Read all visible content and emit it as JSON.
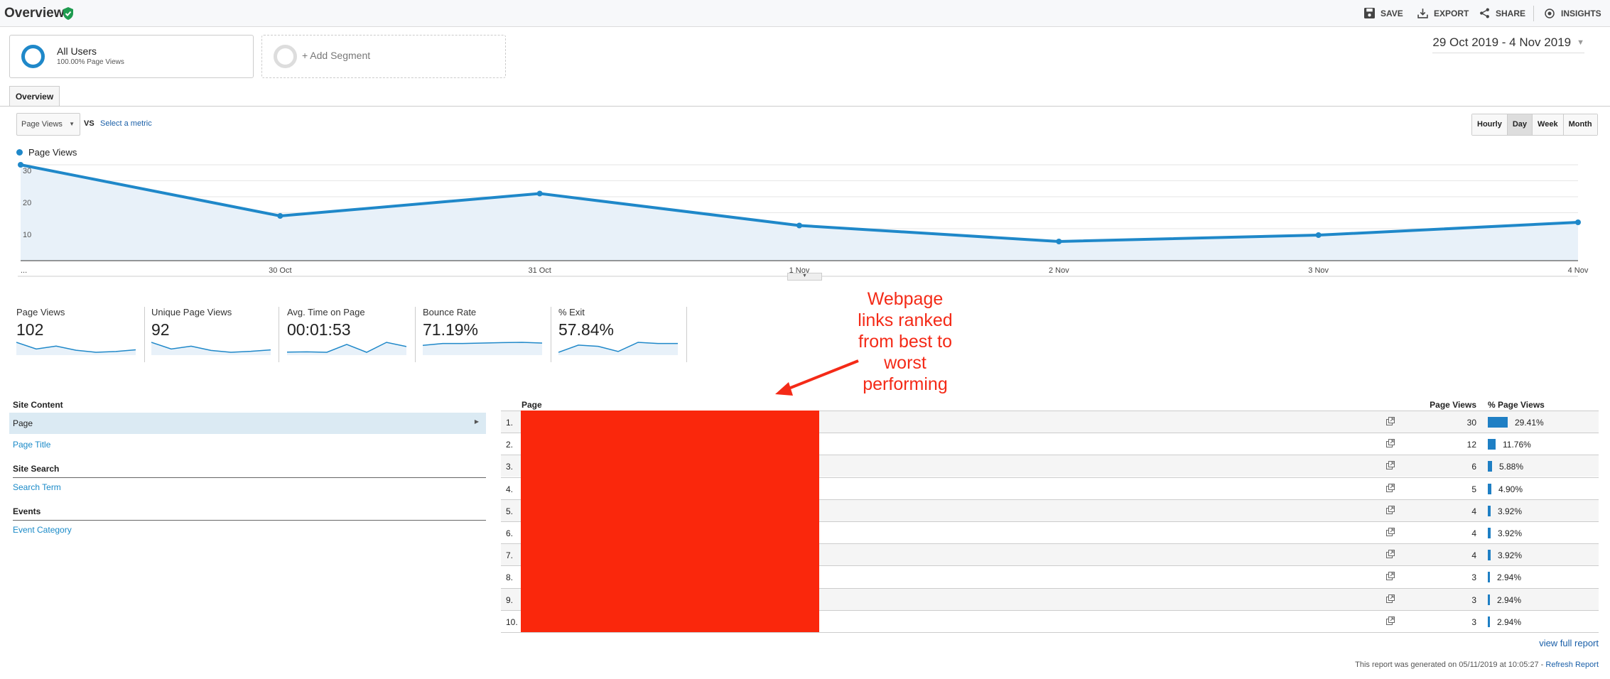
{
  "header": {
    "title": "Overview",
    "verified_icon": "shield-check-icon",
    "actions": [
      {
        "label": "SAVE",
        "icon": "save-icon"
      },
      {
        "label": "EXPORT",
        "icon": "download-icon"
      },
      {
        "label": "SHARE",
        "icon": "share-icon"
      },
      {
        "label": "INSIGHTS",
        "icon": "insights-icon"
      }
    ]
  },
  "segments": {
    "active": {
      "name": "All Users",
      "sub": "100.00% Page Views"
    },
    "add_label": "+ Add Segment"
  },
  "date_range": "29 Oct 2019 - 4 Nov 2019",
  "tabs": [
    {
      "label": "Overview",
      "active": true
    }
  ],
  "metric_select": {
    "value": "Page Views",
    "vs": "VS",
    "secondary": "Select a metric"
  },
  "granularity": {
    "options": [
      "Hourly",
      "Day",
      "Week",
      "Month"
    ],
    "selected": "Day"
  },
  "colors": {
    "accent": "#1f88c9",
    "fill": "#e8f1f9",
    "redaction": "#fa270c",
    "annotation": "#f42a17"
  },
  "chart_data": {
    "type": "area",
    "series": [
      {
        "name": "Page Views",
        "values": [
          30,
          14,
          21,
          11,
          6,
          8,
          12
        ]
      }
    ],
    "x": [
      "...",
      "30 Oct",
      "31 Oct",
      "1 Nov",
      "2 Nov",
      "3 Nov",
      "4 Nov"
    ],
    "y_ticks": [
      "10",
      "20",
      "30"
    ],
    "ylim": [
      0,
      30
    ],
    "grid": true,
    "legend": "top-left"
  },
  "scorecards": [
    {
      "label": "Page Views",
      "value": "102",
      "spark": [
        30,
        14,
        21,
        11,
        6,
        8,
        12
      ]
    },
    {
      "label": "Unique Page Views",
      "value": "92",
      "spark": [
        27,
        13,
        19,
        10,
        6,
        8,
        11
      ]
    },
    {
      "label": "Avg. Time on Page",
      "value": "00:01:53",
      "spark": [
        3,
        4,
        2,
        40,
        2,
        50,
        30
      ]
    },
    {
      "label": "Bounce Rate",
      "value": "71.19%",
      "spark": [
        60,
        68,
        68,
        70,
        72,
        73,
        70
      ]
    },
    {
      "label": "% Exit",
      "value": "57.84%",
      "spark": [
        40,
        58,
        55,
        42,
        65,
        62,
        62
      ]
    }
  ],
  "sidebar": {
    "sections": [
      {
        "title": "Site Content",
        "items": [
          {
            "label": "Page",
            "selected": true
          },
          {
            "label": "Page Title"
          }
        ]
      },
      {
        "title": "Site Search",
        "items": [
          {
            "label": "Search Term"
          }
        ]
      },
      {
        "title": "Events",
        "items": [
          {
            "label": "Event Category"
          }
        ]
      }
    ]
  },
  "table": {
    "headers": {
      "page": "Page",
      "pv": "Page Views",
      "pct": "% Page Views"
    },
    "rows": [
      {
        "n": "1.",
        "pv": "30",
        "pct": "29.41%",
        "pct_value": 29.41
      },
      {
        "n": "2.",
        "pv": "12",
        "pct": "11.76%",
        "pct_value": 11.76
      },
      {
        "n": "3.",
        "pv": "6",
        "pct": "5.88%",
        "pct_value": 5.88
      },
      {
        "n": "4.",
        "pv": "5",
        "pct": "4.90%",
        "pct_value": 4.9
      },
      {
        "n": "5.",
        "pv": "4",
        "pct": "3.92%",
        "pct_value": 3.92
      },
      {
        "n": "6.",
        "pv": "4",
        "pct": "3.92%",
        "pct_value": 3.92
      },
      {
        "n": "7.",
        "pv": "4",
        "pct": "3.92%",
        "pct_value": 3.92
      },
      {
        "n": "8.",
        "pv": "3",
        "pct": "2.94%",
        "pct_value": 2.94
      },
      {
        "n": "9.",
        "pv": "3",
        "pct": "2.94%",
        "pct_value": 2.94
      },
      {
        "n": "10.",
        "pv": "3",
        "pct": "2.94%",
        "pct_value": 2.94
      }
    ],
    "view_full": "view full report"
  },
  "footer": {
    "text": "This report was generated on 05/11/2019 at 10:05:27 - ",
    "refresh": "Refresh Report"
  },
  "annotation": {
    "lines": [
      "Webpage",
      "links ranked",
      "from best to",
      "worst",
      "performing"
    ]
  }
}
